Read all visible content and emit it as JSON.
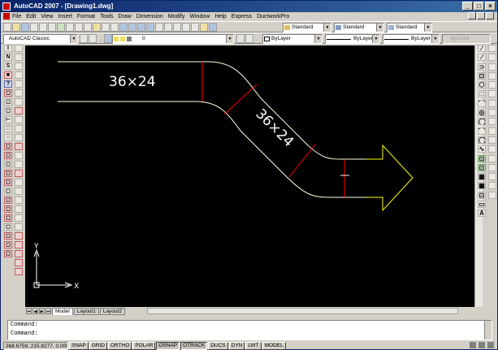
{
  "window": {
    "title": "AutoCAD 2007 - [Drawing1.dwg]",
    "min": "_",
    "max": "□",
    "close": "×"
  },
  "menu": [
    "File",
    "Edit",
    "View",
    "Insert",
    "Format",
    "Tools",
    "Draw",
    "Dimension",
    "Modify",
    "Window",
    "Help",
    "Express",
    "DuctworkPro"
  ],
  "toolbar1": {
    "textstyle": "Standard",
    "dimstyle": "Standard",
    "tablestyle": "Standard"
  },
  "toolbar2": {
    "workspace": "AutoCAD Classic",
    "layer": "0",
    "color": "ByLayer",
    "linetype": "ByLayer",
    "lineweight": "ByLayer",
    "plotstyle": "ByColor"
  },
  "drawing": {
    "label1": "36×24",
    "label2": "36×24",
    "ucs_x": "X",
    "ucs_y": "Y",
    "colors": {
      "duct": "#ffffe0",
      "seam": "#ff0000",
      "arrow": "#ffff00",
      "ucs": "#ffffff"
    }
  },
  "left_palette_1": [
    "I",
    "N",
    "S",
    "■",
    "?",
    "◻",
    "◻",
    "◻",
    "⊢",
    "□",
    "○",
    "◻",
    "◻",
    "◻",
    "◻",
    "◻",
    "◻",
    "◻",
    "◻",
    "◻",
    "◻",
    "◻",
    "◻",
    "◻",
    "◻",
    "◻",
    "◻",
    "◻",
    "◻",
    "◻"
  ],
  "right_palette": [
    "∕",
    "∕",
    "⊃",
    "⊡",
    "⬡",
    "□",
    "⌒",
    "◎",
    "◯",
    "⌒",
    "◯",
    "∿",
    "⊡",
    "⊡",
    "▦",
    "▦",
    "⊡",
    "▭",
    "A"
  ],
  "layout_tabs": [
    "Model",
    "Layout1",
    "Layout2"
  ],
  "command": {
    "line1": "Command:",
    "line2": "Command:"
  },
  "status": {
    "coords": "368.6759, 215.8277, 0.0000",
    "buttons": [
      "SNAP",
      "GRID",
      "ORTHO",
      "POLAR",
      "OSNAP",
      "OTRACK",
      "DUCS",
      "DYN",
      "LWT",
      "MODEL"
    ]
  }
}
